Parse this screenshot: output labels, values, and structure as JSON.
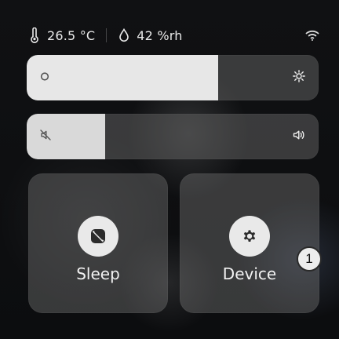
{
  "status_bar": {
    "temperature": "26.5 °C",
    "humidity": "42 %rh",
    "icons": {
      "temperature": "thermometer-icon",
      "humidity": "droplet-icon",
      "wifi": "wifi-icon"
    }
  },
  "controls": {
    "brightness": {
      "level": 0.657,
      "icons": {
        "left": "circle-icon",
        "right": "sun-icon"
      }
    },
    "volume": {
      "level": 0.27,
      "icons": {
        "left": "mute-icon",
        "right": "speaker-icon"
      }
    }
  },
  "tiles": [
    {
      "label": "Sleep",
      "icon": "sleep-icon"
    },
    {
      "label": "Device",
      "icon": "gear-icon"
    }
  ],
  "badge": {
    "value": "1"
  },
  "colors": {
    "background": "#0f1012",
    "tile": "#7a7a7a",
    "slider_fill": "#e7e7e7",
    "text": "#f2f2f2"
  }
}
